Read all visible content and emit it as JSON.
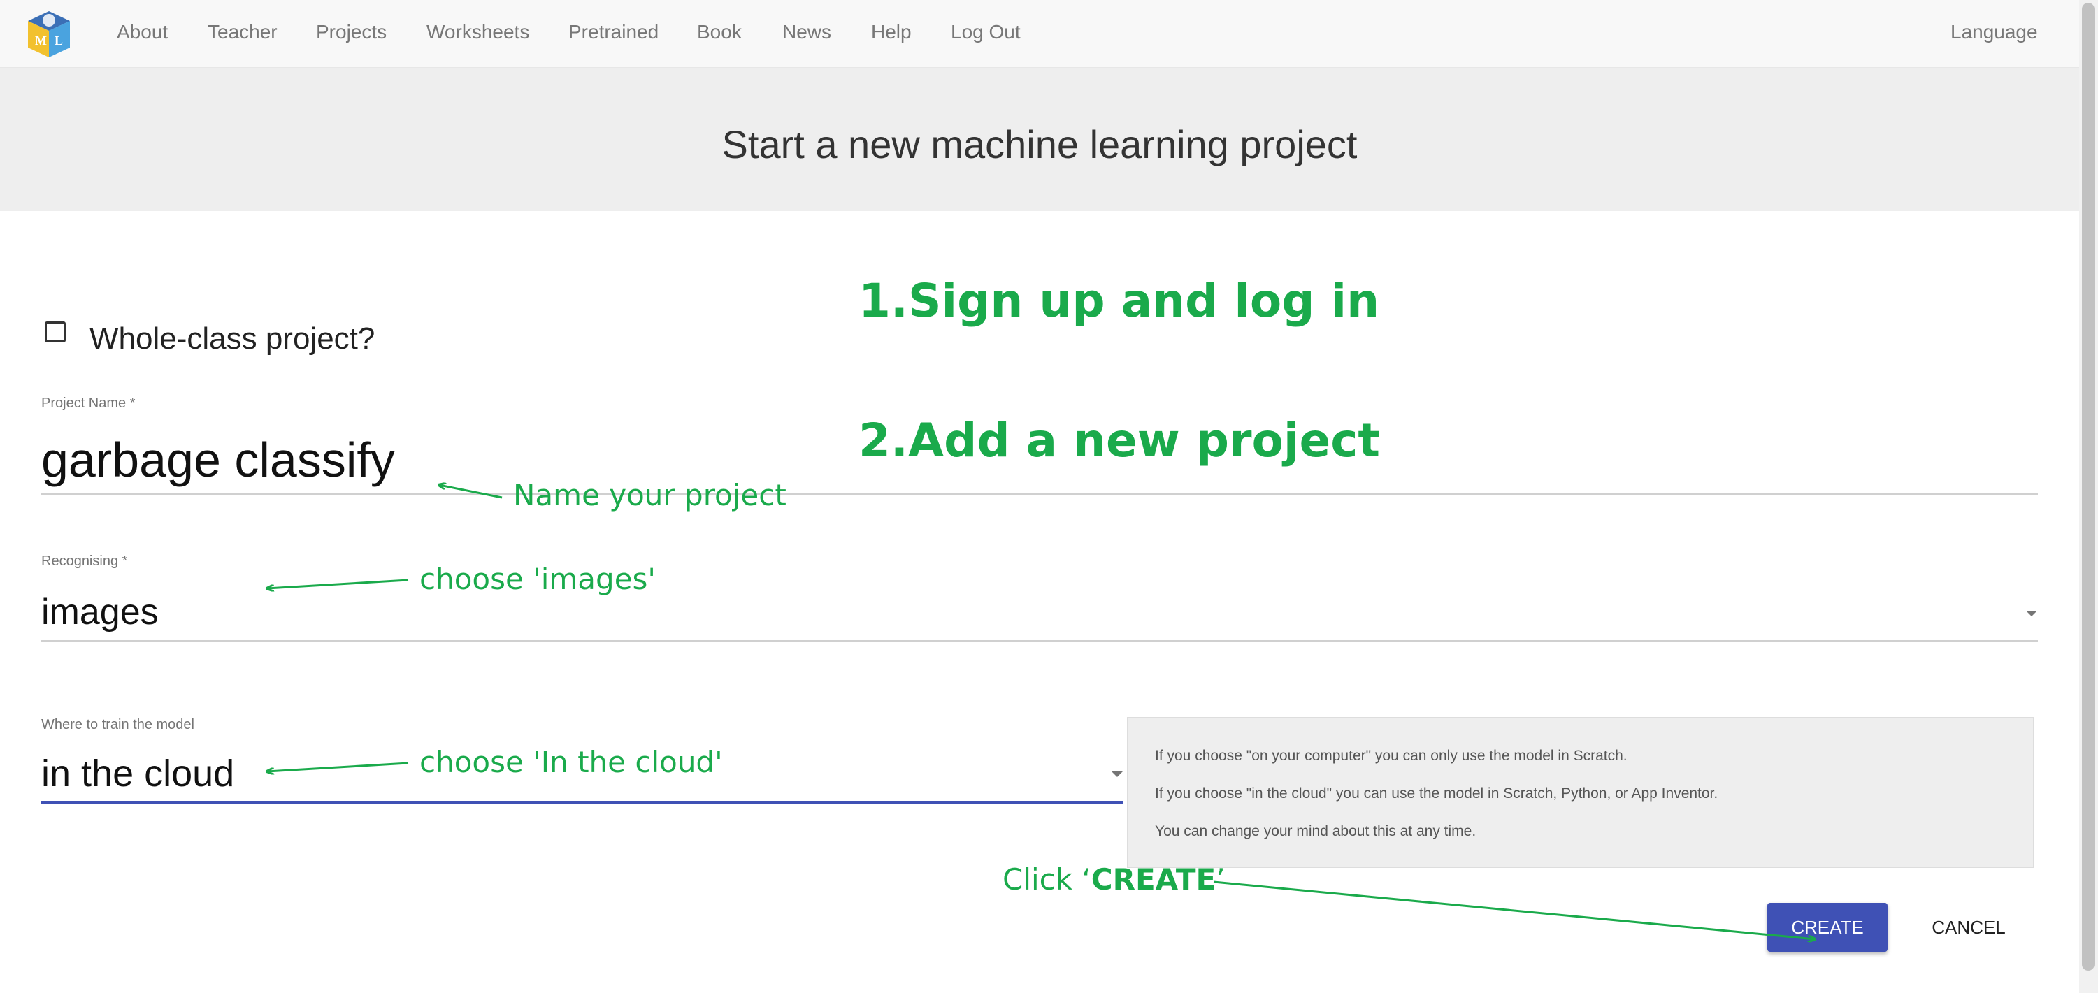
{
  "nav": {
    "items": [
      "About",
      "Teacher",
      "Projects",
      "Worksheets",
      "Pretrained",
      "Book",
      "News",
      "Help",
      "Log Out"
    ],
    "language": "Language"
  },
  "header": {
    "title": "Start a new machine learning project"
  },
  "form": {
    "whole_class_label": "Whole-class project?",
    "project_name_label": "Project Name *",
    "project_name_value": "garbage classify",
    "recognising_label": "Recognising *",
    "recognising_value": "images",
    "where_label": "Where to train the model",
    "where_value": "in the cloud"
  },
  "info": {
    "lines": [
      "If you choose \"on your computer\" you can only use the model in Scratch.",
      "If you choose \"in the cloud\" you can use the model in Scratch, Python, or App Inventor.",
      "You can change your mind about this at any time."
    ]
  },
  "actions": {
    "create": "CREATE",
    "cancel": "CANCEL"
  },
  "annotations": {
    "step1": "1.Sign up and log in",
    "step2": "2.Add a new project",
    "name_hint": "Name your project",
    "images_hint": "choose 'images'",
    "cloud_hint": "choose 'In the cloud'",
    "click_prefix": "Click ‘",
    "click_bold": "CREATE",
    "click_suffix": "’"
  },
  "colors": {
    "accent": "#3f51b5",
    "annotation": "#1aaa4b"
  }
}
